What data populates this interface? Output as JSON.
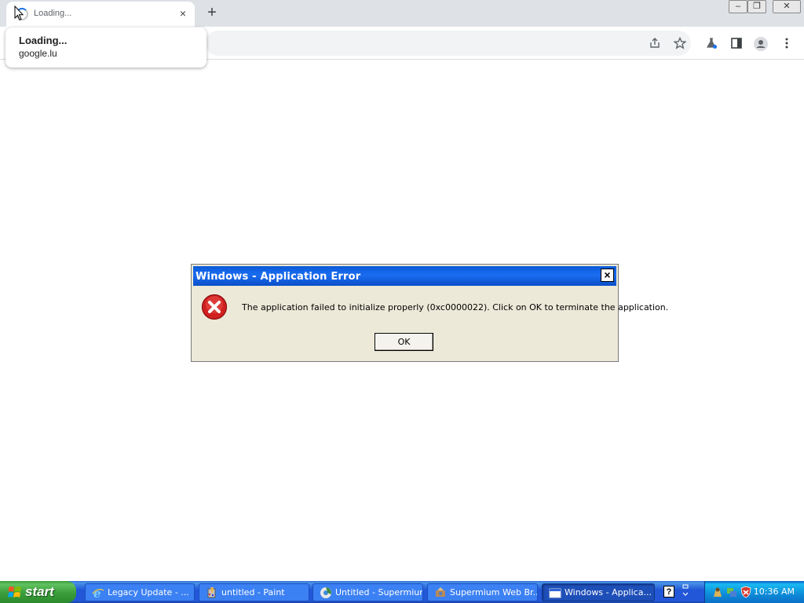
{
  "browser": {
    "tab_title": "Loading...",
    "tab_close_icon": "×",
    "new_tab_icon": "+",
    "window_controls": {
      "minimize": "–",
      "restore": "❐",
      "close": "✕"
    },
    "hover_card": {
      "title": "Loading...",
      "domain": "google.lu"
    },
    "toolbar_icons": [
      "share-icon",
      "star-icon",
      "lab-icon",
      "sidepanel-icon",
      "profile-icon",
      "menu-icon"
    ]
  },
  "dialog": {
    "title": "Windows - Application Error",
    "close_label": "×",
    "icon": "error-icon",
    "message": "The application failed to initialize properly (0xc0000022). Click on OK to terminate the application.",
    "ok_label": "OK"
  },
  "taskbar": {
    "start_label": "start",
    "tasks": [
      {
        "label": "Legacy Update - ...",
        "icon": "ie-icon",
        "active": false
      },
      {
        "label": "untitled - Paint",
        "icon": "paint-icon",
        "active": false
      },
      {
        "label": "Untitled - Supermium",
        "icon": "supermium-icon",
        "active": false
      },
      {
        "label": "Supermium Web Br...",
        "icon": "installer-icon",
        "active": false
      },
      {
        "label": "Windows - Applica...",
        "icon": "window-icon",
        "active": true
      }
    ],
    "help_label": "?",
    "clock": "10:36 AM"
  },
  "colors": {
    "taskbar_blue": "#2457d8",
    "start_green": "#3a9d3a",
    "dialog_face": "#ece9d8",
    "titlebar_blue": "#0a5bd8",
    "error_red": "#d0201f"
  }
}
